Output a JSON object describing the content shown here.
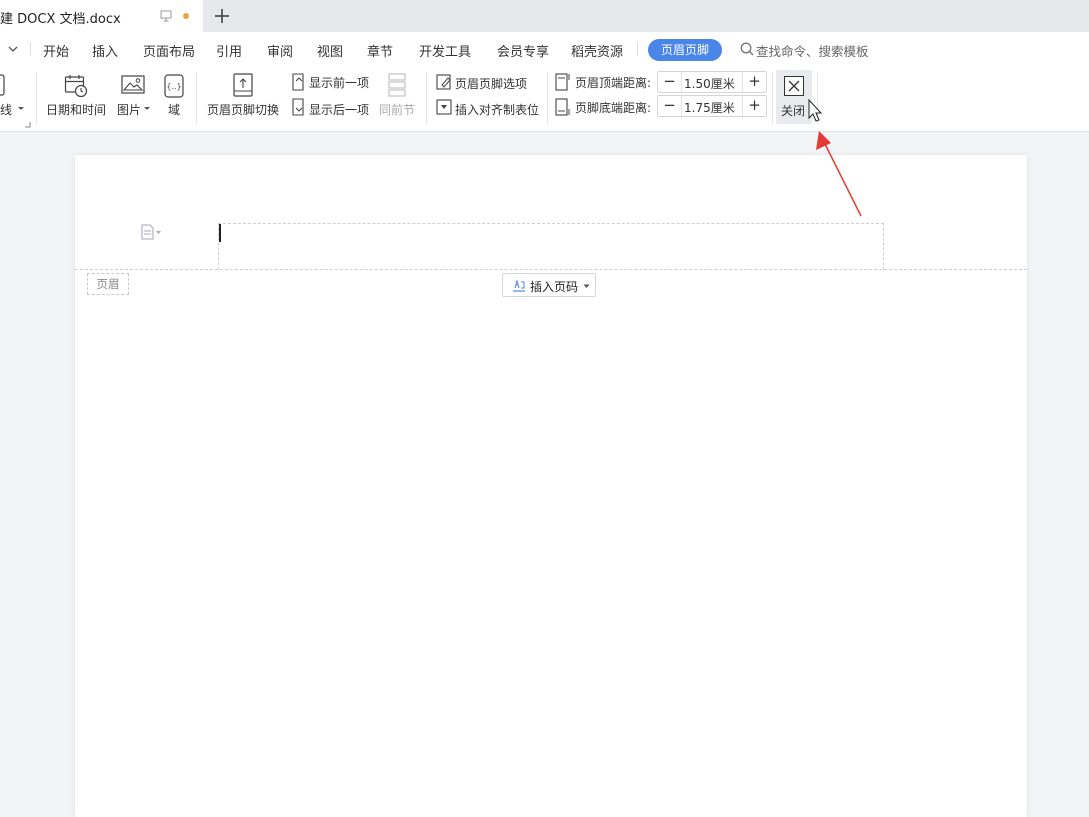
{
  "tabbar": {
    "doc_title": "建 DOCX 文档.docx",
    "new_tab_label": "+"
  },
  "menu": {
    "items": [
      "开始",
      "插入",
      "页面布局",
      "引用",
      "审阅",
      "视图",
      "章节",
      "开发工具",
      "会员专享",
      "稻壳资源"
    ],
    "active": "页眉页脚",
    "search_placeholder": "查找命令、搜索模板"
  },
  "ribbon": {
    "partial_label": "线",
    "date_time": "日期和时间",
    "picture": "图片",
    "field": "域",
    "switch": "页眉页脚切换",
    "show_prev": "显示前一项",
    "show_next": "显示后一项",
    "same_as_prev": "同前节",
    "options": "页眉页脚选项",
    "insert_align_tab": "插入对齐制表位",
    "header_top_label": "页眉顶端距离:",
    "header_top_value": "1.50厘米",
    "footer_bottom_label": "页脚底端距离:",
    "footer_bottom_value": "1.75厘米",
    "minus": "−",
    "plus": "+",
    "close": "关闭"
  },
  "document": {
    "header_tag": "页眉",
    "insert_page_number": "插入页码"
  },
  "colors": {
    "accent": "#4a86e8",
    "unsaved_dot": "#e9a23b",
    "annotation_arrow": "#e53935"
  }
}
